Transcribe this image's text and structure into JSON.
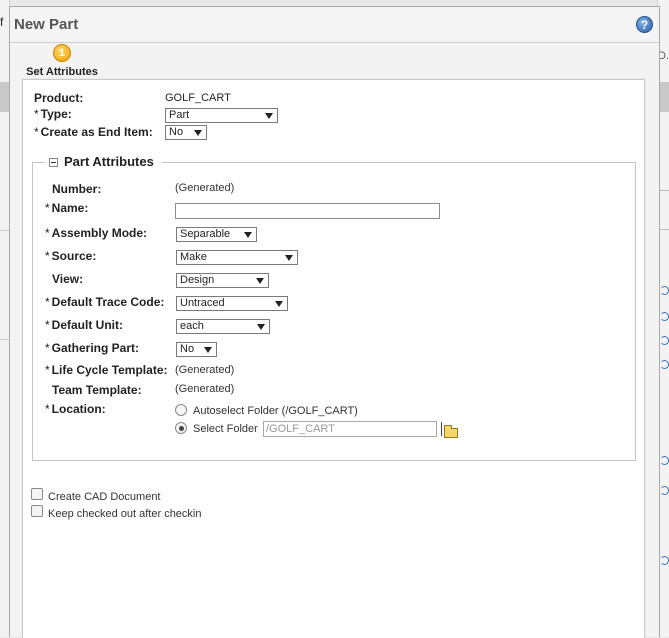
{
  "background": {
    "left_fragment": "f",
    "right_fragment": "D."
  },
  "dialog": {
    "title": "New Part",
    "help_icon": "?",
    "step": {
      "number": "1",
      "label": "Set Attributes"
    }
  },
  "top_fields": {
    "product": {
      "label": "Product:",
      "value": "GOLF_CART"
    },
    "type": {
      "label": "Type:",
      "required": "*",
      "value": "Part"
    },
    "end_item": {
      "label": "Create as End Item:",
      "required": "*",
      "value": "No"
    }
  },
  "part_attributes": {
    "legend": "Part Attributes",
    "number": {
      "label": "Number:",
      "value": "(Generated)"
    },
    "name": {
      "label": "Name:",
      "required": "*",
      "value": ""
    },
    "assembly_mode": {
      "label": "Assembly Mode:",
      "required": "*",
      "value": "Separable"
    },
    "source": {
      "label": "Source:",
      "required": "*",
      "value": "Make"
    },
    "view": {
      "label": "View:",
      "value": "Design"
    },
    "default_trace_code": {
      "label": "Default Trace Code:",
      "required": "*",
      "value": "Untraced"
    },
    "default_unit": {
      "label": "Default Unit:",
      "required": "*",
      "value": "each"
    },
    "gathering_part": {
      "label": "Gathering Part:",
      "required": "*",
      "value": "No"
    },
    "life_cycle_template": {
      "label": "Life Cycle Template:",
      "required": "*",
      "value": "(Generated)"
    },
    "team_template": {
      "label": "Team Template:",
      "value": "(Generated)"
    },
    "location": {
      "label": "Location:",
      "required": "*",
      "autoselect_label": "Autoselect Folder (/GOLF_CART)",
      "select_label": "Select Folder",
      "select_value": "/GOLF_CART",
      "selected": "select"
    }
  },
  "options": {
    "create_cad": {
      "label": "Create CAD Document",
      "checked": false
    },
    "keep_checked_out": {
      "label": "Keep checked out after checkin",
      "checked": false
    }
  },
  "icons": [
    "help-icon",
    "step-number-icon",
    "collapse-icon",
    "folder-icon"
  ],
  "colors": {
    "help_blue": "#2a5fa8",
    "step_orange": "#f0a000"
  }
}
